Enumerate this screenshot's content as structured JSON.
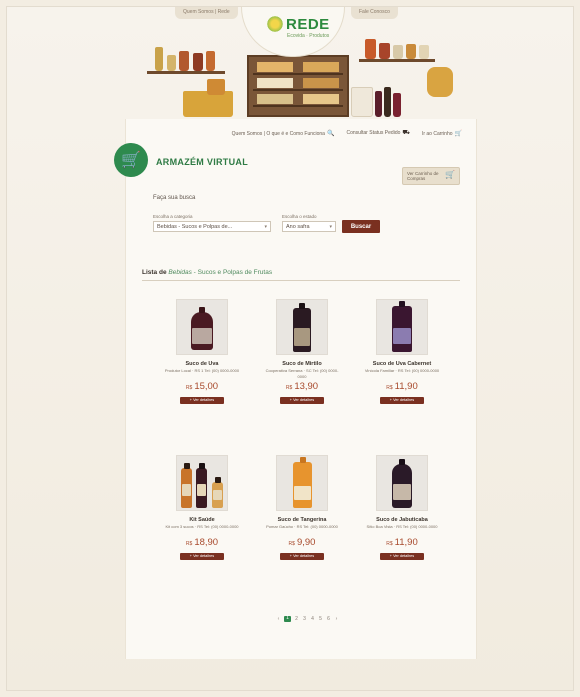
{
  "header": {
    "top_left_link": "Quem Somos | Rede",
    "top_right_link": "Fale Conosco",
    "logo_text": "REDE",
    "logo_subtitle": "Ecovida · Produtos"
  },
  "toplinks": [
    {
      "label": "Quem Somos | O que é e Como Funciona",
      "icon": "search-icon"
    },
    {
      "label": "Consultar Status Pedido",
      "icon": "truck-icon"
    },
    {
      "label": "Ir ao Carrinho",
      "icon": "cart-icon"
    }
  ],
  "page": {
    "title": "ARMAZÉM VIRTUAL",
    "cart_button": "Ver Carrinho de Compras"
  },
  "search": {
    "heading": "Faça sua busca",
    "category_label": "Escolha a categoria",
    "category_value": "Bebidas - Sucos e Polpas de...",
    "state_label": "Escolha o estado",
    "state_value": "Ano safra",
    "button": "Buscar"
  },
  "list": {
    "prefix": "Lista de ",
    "category": "Bebidas",
    "sep": " - ",
    "subcategory": "Sucos e Polpas de Frutas"
  },
  "products": [
    {
      "name": "Suco de Uva",
      "desc": "Produtor Local · RS 1 Tel: (00) 0000-0000",
      "currency": "R$",
      "price": "15,00",
      "button": "Ver detalhes",
      "liquid": "#4a1a22",
      "label": "#b9a8a0"
    },
    {
      "name": "Suco de Mirtilo",
      "desc": "Cooperativa Serrana · SC Tel: (00) 0000-0000",
      "currency": "R$",
      "price": "13,90",
      "button": "Ver detalhes",
      "liquid": "#2a1a22",
      "label": "#a89880"
    },
    {
      "name": "Suco de Uva Cabernet",
      "desc": "Vinícola Familiar · RS Tel: (00) 0000-0000",
      "currency": "R$",
      "price": "11,90",
      "button": "Ver detalhes",
      "liquid": "#3a1630",
      "label": "#8b7cb0"
    },
    {
      "name": "Kit Saúde",
      "desc": "Kit com 3 sucos · RS Tel: (00) 0000-0000",
      "currency": "R$",
      "price": "18,90",
      "button": "Ver detalhes",
      "liquid": "#c8742a",
      "label": "#e6d7b8"
    },
    {
      "name": "Suco de Tangerina",
      "desc": "Pomar Gaúcho · RS Tel: (00) 0000-0000",
      "currency": "R$",
      "price": "9,90",
      "button": "Ver detalhes",
      "liquid": "#e7942e",
      "label": "#f1e4c8"
    },
    {
      "name": "Suco de Jabuticaba",
      "desc": "Sítio Boa Vista · RS Tel: (00) 0000-0000",
      "currency": "R$",
      "price": "11,90",
      "button": "Ver detalhes",
      "liquid": "#2a1a28",
      "label": "#c6b8a8"
    }
  ],
  "pagination": {
    "prev": "‹",
    "pages": [
      "1",
      "2",
      "3",
      "4",
      "5",
      "6"
    ],
    "active": "1",
    "next": "›"
  },
  "colors": {
    "brand_green": "#2e8a4e",
    "accent_brown": "#7a3020",
    "price_red": "#a84a2c"
  }
}
